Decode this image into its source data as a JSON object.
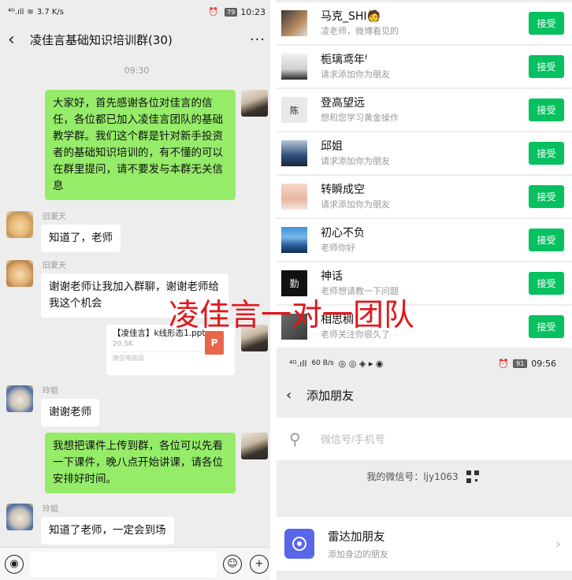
{
  "left_status": {
    "signal": "⁴ᴳ.ıll",
    "wifi": "≋",
    "speed": "3.7 K/s",
    "alarm": "⏰",
    "battery": "79",
    "time": "10:23"
  },
  "chat": {
    "title": "凌佳言基础知识培训群(30)",
    "timestamp": "09:30",
    "messages": [
      {
        "sender": "",
        "text": "大家好，首先感谢各位对佳言的信任，各位都已加入凌佳言团队的基础教学群。我们这个群是针对新手投资者的基础知识培训的，有不懂的可以在群里提问，请不要发与本群无关信息"
      },
      {
        "sender": "旧夏天",
        "text": "知道了，老师"
      },
      {
        "sender": "旧夏天",
        "text": "谢谢老师让我加入群聊，谢谢老师给我这个机会"
      },
      {
        "sender": "玲姐",
        "text": "谢谢老师"
      },
      {
        "sender": "",
        "text": "我想把课件上传到群，各位可以先看一下课件，晚八点开始讲课，请各位安排好时间。"
      },
      {
        "sender": "玲姐",
        "text": "知道了老师，一定会到场"
      }
    ],
    "file": {
      "name": "【凌佳言】k线形态1.ppt",
      "size": "20.5K",
      "source": "微信电脑版",
      "type_label": "P"
    }
  },
  "friend_requests": [
    {
      "name": "马克_SHI🧑",
      "message": "凌老师，微博看见的",
      "avatar_text": ""
    },
    {
      "name": "栀璃鸢年ᶠ",
      "message": "请求添加你为朋友",
      "avatar_text": ""
    },
    {
      "name": "登高望远",
      "message": "想和您学习黄金操作",
      "avatar_text": "陈"
    },
    {
      "name": "邱姐",
      "message": "请求添加你为朋友",
      "avatar_text": ""
    },
    {
      "name": "转瞬成空",
      "message": "请求添加你为朋友",
      "avatar_text": ""
    },
    {
      "name": "初心不负",
      "message": "老师你好",
      "avatar_text": ""
    },
    {
      "name": "神话",
      "message": "老师想请教一下问题",
      "avatar_text": "勤"
    },
    {
      "name": "相思稠",
      "message": "老师关注你很久了",
      "avatar_text": ""
    }
  ],
  "accept_label": "接受",
  "right_status": {
    "signal": "⁴ᴳ.ıll",
    "speed": "60 B/s",
    "battery": "91",
    "time": "09:56"
  },
  "add_friend": {
    "title": "添加朋友",
    "search_placeholder": "微信号/手机号",
    "my_id": "我的微信号：ljy1063",
    "radar_title": "雷达加朋友",
    "radar_subtitle": "添加身边的朋友"
  },
  "watermark": "凌佳言一对一团队",
  "colors": {
    "wechat_green": "#07c160",
    "bubble_green": "#95ec69",
    "watermark_red": "#e0171d",
    "radar_blue": "#5866e8"
  }
}
